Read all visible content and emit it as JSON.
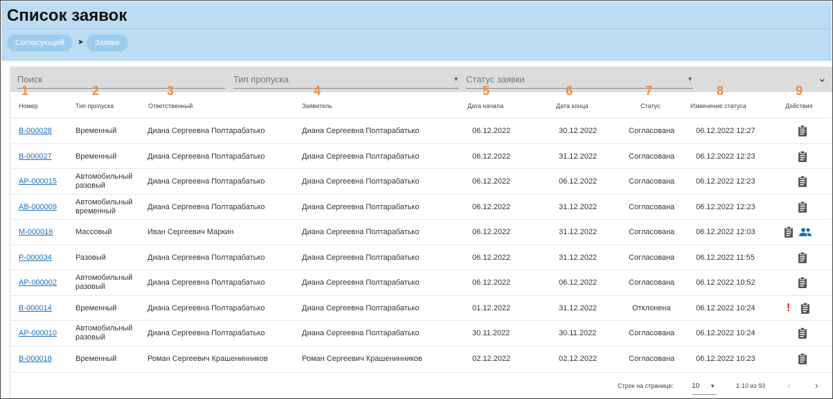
{
  "page": {
    "title": "Список заявок"
  },
  "breadcrumb": [
    {
      "label": "Согласующий"
    },
    {
      "label": "Заявки"
    }
  ],
  "filters": {
    "search_placeholder": "Поиск",
    "pass_type_placeholder": "Тип пропуска",
    "status_placeholder": "Статус заявки"
  },
  "markers": [
    "1",
    "2",
    "3",
    "4",
    "5",
    "6",
    "7",
    "8",
    "9"
  ],
  "columns": {
    "number": "Номер",
    "pass_type": "Тип пропуска",
    "responsible": "Ответственный",
    "applicant": "Заявитель",
    "start_date": "Дата начала",
    "end_date": "Дата конца",
    "status": "Статус",
    "status_change": "Изменение статуса",
    "actions": "Действия"
  },
  "rows": [
    {
      "number": "В-000028",
      "pass_type": "Временный",
      "responsible": "Диана Сергеевна Полтарабатько",
      "applicant": "Диана Сергеевна Полтарабатько",
      "start": "06.12.2022",
      "end": "30.12.2022",
      "status": "Согласована",
      "changed": "06.12.2022 12:27",
      "icons": [
        "clipboard-icon"
      ]
    },
    {
      "number": "В-000027",
      "pass_type": "Временный",
      "responsible": "Диана Сергеевна Полтарабатько",
      "applicant": "Диана Сергеевна Полтарабатько",
      "start": "06.12.2022",
      "end": "31.12.2022",
      "status": "Согласована",
      "changed": "06.12.2022 12:23",
      "icons": [
        "clipboard-icon"
      ]
    },
    {
      "number": "АР-000015",
      "pass_type": "Автомобильный разовый",
      "responsible": "Диана Сергеевна Полтарабатько",
      "applicant": "Диана Сергеевна Полтарабатько",
      "start": "06.12.2022",
      "end": "06.12.2022",
      "status": "Согласована",
      "changed": "06.12.2022 12:23",
      "icons": [
        "clipboard-icon"
      ]
    },
    {
      "number": "АВ-000009",
      "pass_type": "Автомобильный временный",
      "responsible": "Диана Сергеевна Полтарабатько",
      "applicant": "Диана Сергеевна Полтарабатько",
      "start": "06.12.2022",
      "end": "31.12.2022",
      "status": "Согласована",
      "changed": "06.12.2022 12:23",
      "icons": [
        "clipboard-icon"
      ]
    },
    {
      "number": "М-000016",
      "pass_type": "Массовый",
      "responsible": "Иван Сергеевич Маркин",
      "applicant": "Диана Сергеевна Полтарабатько",
      "start": "06.12.2022",
      "end": "31.12.2022",
      "status": "Согласована",
      "changed": "06.12.2022 12:03",
      "icons": [
        "clipboard-icon",
        "group-icon"
      ]
    },
    {
      "number": "Р-000034",
      "pass_type": "Разовый",
      "responsible": "Диана Сергеевна Полтарабатько",
      "applicant": "Диана Сергеевна Полтарабатько",
      "start": "06.12.2022",
      "end": "31.12.2022",
      "status": "Согласована",
      "changed": "06.12.2022 11:55",
      "icons": [
        "clipboard-icon"
      ]
    },
    {
      "number": "АР-000002",
      "pass_type": "Автомобильный разовый",
      "responsible": "Диана Сергеевна Полтарабатько",
      "applicant": "Диана Сергеевна Полтарабатько",
      "start": "06.12.2022",
      "end": "06.12.2022",
      "status": "Согласована",
      "changed": "06.12.2022 10:52",
      "icons": [
        "clipboard-icon"
      ]
    },
    {
      "number": "В-000014",
      "pass_type": "Временный",
      "responsible": "Диана Сергеевна Полтарабатько",
      "applicant": "Диана Сергеевна Полтарабатько",
      "start": "01.12.2022",
      "end": "31.12.2022",
      "status": "Отклонена",
      "changed": "06.12.2022 10:24",
      "icons": [
        "alert-icon",
        "clipboard-icon"
      ]
    },
    {
      "number": "АР-000010",
      "pass_type": "Автомобильный разовый",
      "responsible": "Диана Сергеевна Полтарабатько",
      "applicant": "Диана Сергеевна Полтарабатько",
      "start": "30.11.2022",
      "end": "30.11.2022",
      "status": "Согласована",
      "changed": "06.12.2022 10:24",
      "icons": [
        "clipboard-icon"
      ]
    },
    {
      "number": "В-000018",
      "pass_type": "Временный",
      "responsible": "Роман Сергеевич Крашенинников",
      "applicant": "Роман Сергеевич Крашенинников",
      "start": "02.12.2022",
      "end": "02.12.2022",
      "status": "Согласована",
      "changed": "06.12.2022 10:23",
      "icons": [
        "clipboard-icon"
      ]
    }
  ],
  "pagination": {
    "rows_per_page_label": "Строк на странице:",
    "rows_per_page_value": "10",
    "range_text": "1-10 из 93",
    "prev_icon": "chevron-left-icon",
    "next_icon": "chevron-right-icon"
  },
  "colors": {
    "header_bg": "#bcdcf4",
    "crumb_bg": "#9ccbee",
    "link": "#1a6fc0",
    "marker": "#f28a3c",
    "alert": "#e01c1c"
  }
}
